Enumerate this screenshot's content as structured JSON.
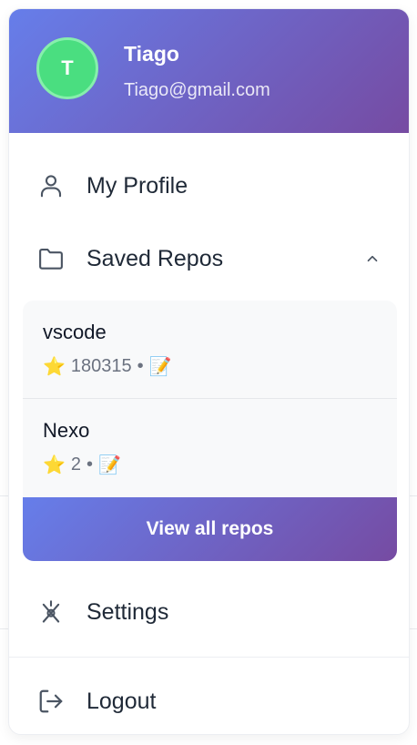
{
  "user": {
    "initial": "T",
    "name": "Tiago",
    "email": "Tiago@gmail.com"
  },
  "menu": {
    "profile_label": "My Profile",
    "saved_repos_label": "Saved Repos",
    "settings_label": "Settings",
    "logout_label": "Logout"
  },
  "repos": [
    {
      "name": "vscode",
      "star": "⭐",
      "stars": "180315",
      "sep": "•",
      "edit": "📝"
    },
    {
      "name": "Nexo",
      "star": "⭐",
      "stars": "2",
      "sep": "•",
      "edit": "📝"
    }
  ],
  "view_all_label": "View all repos",
  "colors": {
    "gradient_start": "#667eea",
    "gradient_end": "#764ba2",
    "avatar_bg": "#4ade80"
  },
  "icons": {
    "profile": "user-icon",
    "saved_repos": "folder-icon",
    "collapse": "chevron-up-icon",
    "settings": "settings-icon",
    "logout": "logout-icon"
  }
}
